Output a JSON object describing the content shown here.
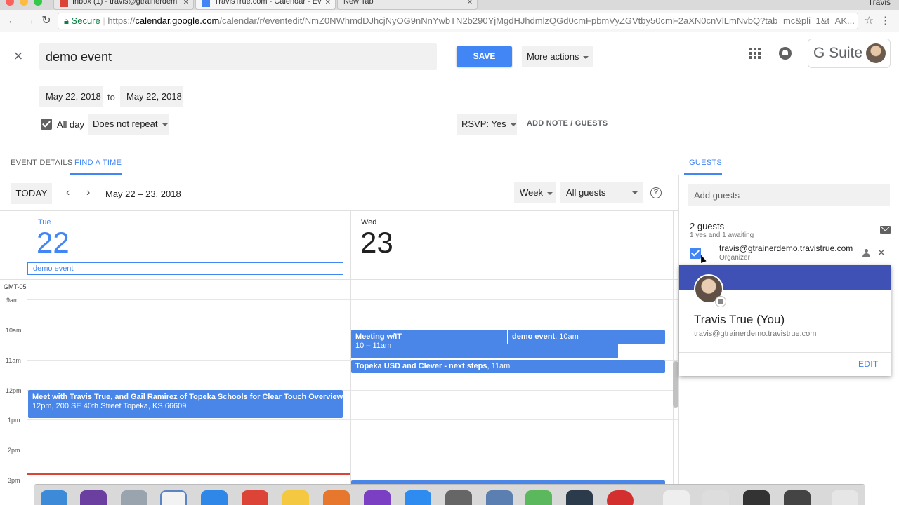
{
  "browser": {
    "tabs": [
      {
        "title": "Inbox (1) - travis@gtrainerdem"
      },
      {
        "title": "TravisTrue.com - Calendar - Ev"
      },
      {
        "title": "New Tab"
      }
    ],
    "user": "Travis",
    "secure_label": "Secure",
    "url_scheme": "https://",
    "url_domain": "calendar.google.com",
    "url_path": "/calendar/r/eventedit/NmZ0NWhmdDJhcjNyOG9nNnYwbTN2b290YjMgdHJhdmlzQGd0cmFpbmVyZGVtby50cmF2aXN0cnVlLmNvbQ?tab=mc&pli=1&t=AK..."
  },
  "editor": {
    "title_value": "demo event",
    "save_label": "SAVE",
    "more_actions_label": "More actions",
    "brand_label": "G Suite",
    "start_date": "May 22, 2018",
    "to_label": "to",
    "end_date": "May 22, 2018",
    "allday_label": "All day",
    "repeat_label": "Does not repeat",
    "rsvp_label": "RSVP: Yes",
    "add_note_label": "ADD NOTE / GUESTS"
  },
  "tabs": {
    "event_details": "EVENT DETAILS",
    "find_a_time": "FIND A TIME",
    "guests": "GUESTS"
  },
  "calendar": {
    "today_label": "TODAY",
    "range_label": "May 22 – 23, 2018",
    "view_label": "Week",
    "guests_filter_label": "All guests",
    "timezone": "GMT-05",
    "days": [
      {
        "dow": "Tue",
        "num": "22"
      },
      {
        "dow": "Wed",
        "num": "23"
      }
    ],
    "allday_event": "demo event",
    "hours": [
      "9am",
      "10am",
      "11am",
      "12pm",
      "1pm",
      "2pm",
      "3pm"
    ],
    "events": {
      "meeting_title": "Meeting w/IT",
      "meeting_time": "10 – 11am",
      "demo_title": "demo event",
      "demo_time": ", 10am",
      "topeka_title": "Topeka USD and Clever - next steps",
      "topeka_time": ", 11am",
      "lunch_title": "Meet with Travis True, and Gail Ramirez of Topeka Schools for Clear Touch Overview/Lunch a",
      "lunch_detail": "12pm, 200 SE 40th Street Topeka, KS 66609"
    }
  },
  "guests_panel": {
    "add_guests_placeholder": "Add guests",
    "count_label": "2 guests",
    "status_label": "1 yes and 1 awaiting",
    "guest_email": "travis@gtrainerdemo.travistrue.com",
    "guest_role": "Organizer",
    "card": {
      "name": "Travis True (You)",
      "email": "travis@gtrainerdemo.travistrue.com",
      "edit_label": "EDIT"
    }
  },
  "colors": {
    "accent": "#4285f4",
    "event_blue": "#4a86e8",
    "card_band": "#3f51b5",
    "now_line": "#db4437"
  }
}
